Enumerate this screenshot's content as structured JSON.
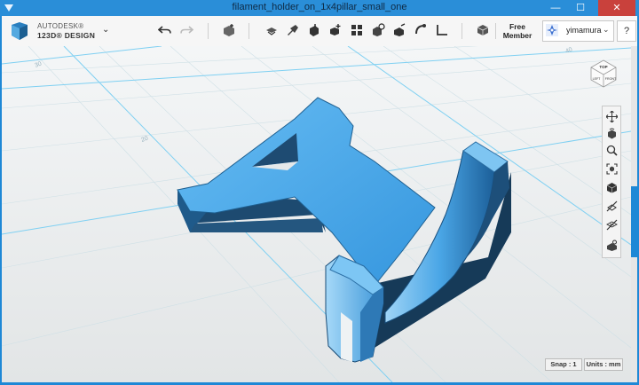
{
  "window": {
    "title": "filament_holder_on_1x4pillar_small_one",
    "minimize_glyph": "—",
    "maximize_glyph": "☐",
    "close_glyph": "✕"
  },
  "brand": {
    "line1": "AUTODESK®",
    "line2": "123D® DESIGN",
    "menu_caret": "⌄"
  },
  "toolbar": {
    "icons": [
      "undo-icon",
      "redo-icon",
      "primitives-icon",
      "sketch-icon",
      "construct-icon",
      "modify-icon",
      "pattern-icon",
      "grouping-icon",
      "combine-icon",
      "snap-icon",
      "measure-icon",
      "material-icon"
    ]
  },
  "account": {
    "member_line1": "Free",
    "member_line2": "Member",
    "username": "yimamura",
    "caret": "⌄",
    "help": "?"
  },
  "viewcube": {
    "top": "TOP",
    "left": "LEFT",
    "front": "FRONT"
  },
  "grid": {
    "label_a": "30",
    "label_b": "20",
    "label_c": "40"
  },
  "status": {
    "snap": "Snap : 1",
    "units": "Units : mm"
  },
  "colors": {
    "accent": "#1e88d6",
    "model": "#3aa3e8",
    "grid_line": "#7fd0f2"
  }
}
